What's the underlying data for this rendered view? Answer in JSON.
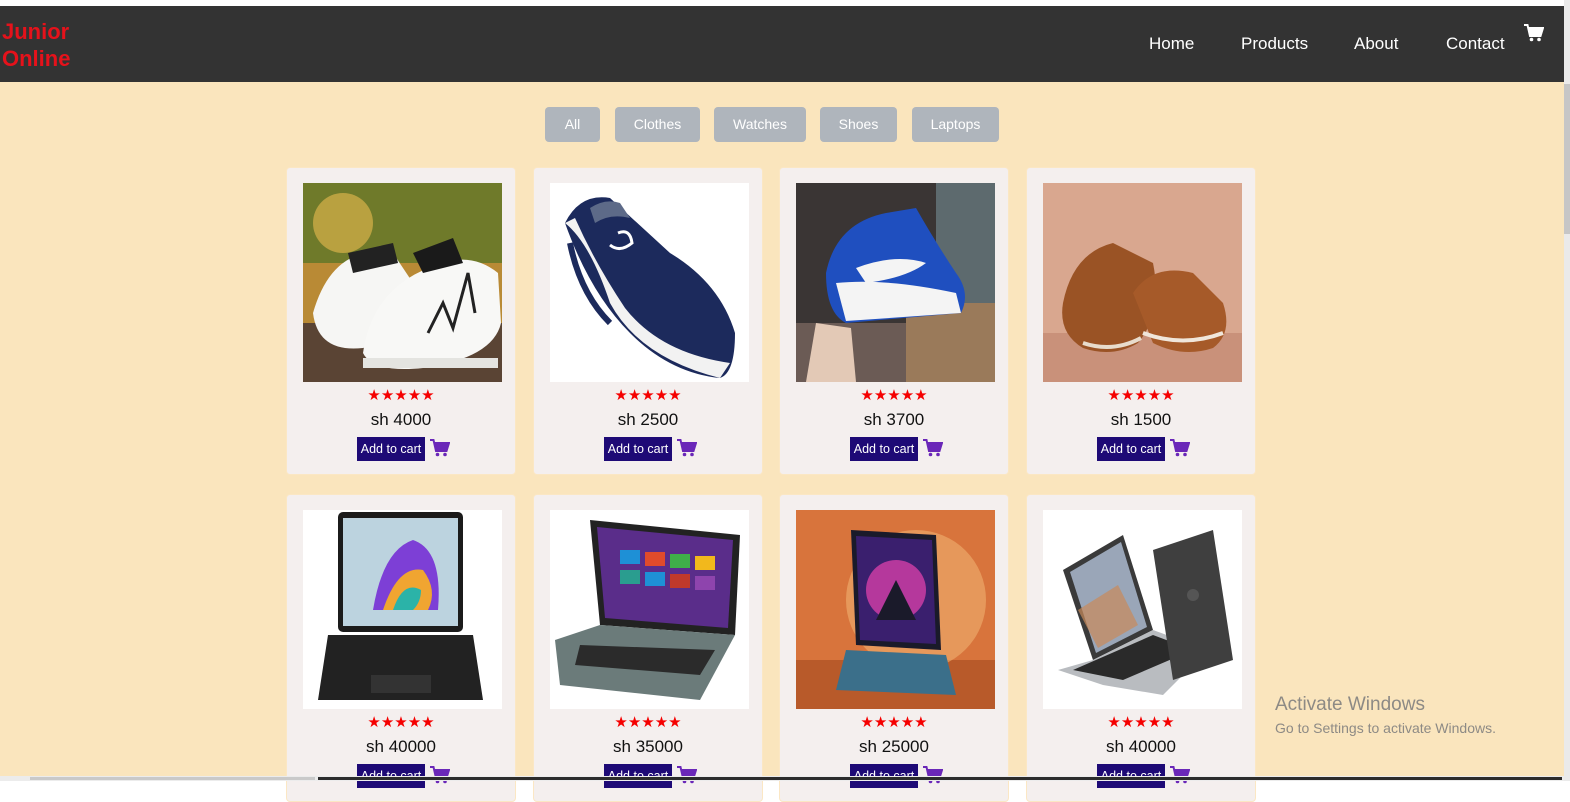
{
  "brand": {
    "line1": "Junior",
    "line2": "Online",
    "color": "#e5121b"
  },
  "nav": {
    "items": [
      "Home",
      "Products",
      "About",
      "Contact"
    ],
    "cart_icon": "cart-icon"
  },
  "filters": [
    "All",
    "Clothes",
    "Watches",
    "Shoes",
    "Laptops"
  ],
  "product_common": {
    "stars": "★★★★★",
    "rating": 5,
    "add_label": "Add to cart",
    "cart_icon": "cart-icon"
  },
  "products": [
    {
      "category": "Shoes",
      "price": "sh 4000",
      "image": "white-sneakers"
    },
    {
      "category": "Shoes",
      "price": "sh 2500",
      "image": "navy-running-shoe"
    },
    {
      "category": "Shoes",
      "price": "sh 3700",
      "image": "blue-white-high-top"
    },
    {
      "category": "Shoes",
      "price": "sh 1500",
      "image": "brown-leather-shoes"
    },
    {
      "category": "Laptops",
      "price": "sh 40000",
      "image": "black-laptop"
    },
    {
      "category": "Laptops",
      "price": "sh 35000",
      "image": "silver-windows-laptop"
    },
    {
      "category": "Laptops",
      "price": "sh 25000",
      "image": "gaming-laptop"
    },
    {
      "category": "Laptops",
      "price": "sh 40000",
      "image": "macbook-case"
    }
  ],
  "watermark": {
    "title": "Activate Windows",
    "subtitle": "Go to Settings to activate Windows."
  },
  "colors": {
    "navbar": "#333333",
    "page_background": "#fae5bd",
    "filter_button": "#afb5bc",
    "add_button": "#1e0a76",
    "stars": "#f50000",
    "cart_icon": "#6a27b8"
  }
}
